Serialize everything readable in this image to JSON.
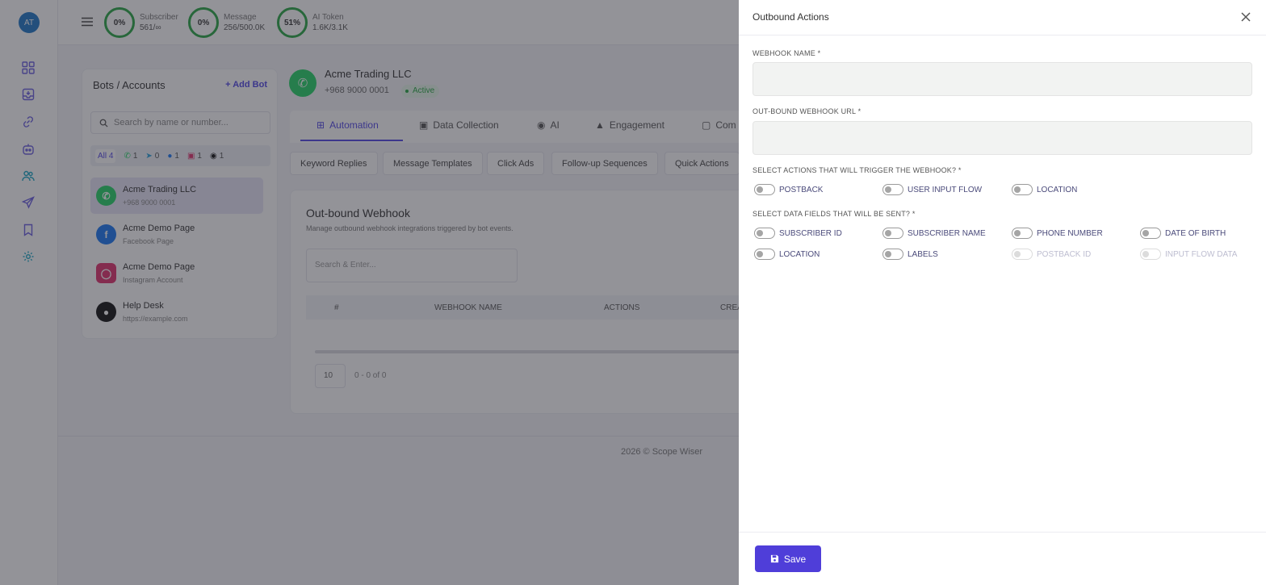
{
  "user": {
    "initials": "AT"
  },
  "stats": [
    {
      "percent": "0%",
      "label": "Subscriber",
      "value": "561/∞"
    },
    {
      "percent": "0%",
      "label": "Message",
      "value": "256/500.0K"
    },
    {
      "percent": "51%",
      "label": "AI Token",
      "value": "1.6K/3.1K"
    }
  ],
  "bots_panel": {
    "title": "Bots / Accounts",
    "add_label": "Add Bot",
    "search_placeholder": "Search by name or number...",
    "filters": {
      "all": "All 4",
      "whatsapp": "1",
      "telegram": "0",
      "facebook": "1",
      "instagram": "1",
      "threads": "1"
    },
    "items": [
      {
        "name": "Acme Trading LLC",
        "sub": "+968 9000 0001",
        "icon": "whatsapp-icon",
        "color": "#25d366"
      },
      {
        "name": "Acme Demo Page",
        "sub": "Facebook Page",
        "icon": "facebook-icon",
        "color": "#1877f2"
      },
      {
        "name": "Acme Demo Page",
        "sub": "Instagram Account",
        "icon": "instagram-icon",
        "color": "#e1306c"
      },
      {
        "name": "Help Desk",
        "sub": "https://example.com",
        "icon": "chat-icon",
        "color": "#111111"
      }
    ]
  },
  "account": {
    "name": "Acme Trading LLC",
    "number": "+968 9000 0001",
    "status": "Active"
  },
  "tabs": [
    "Automation",
    "Data Collection",
    "AI",
    "Engagement",
    "Com"
  ],
  "subtabs": [
    "Keyword Replies",
    "Message Templates",
    "Click Ads",
    "Follow-up Sequences",
    "Quick Actions"
  ],
  "webhook_card": {
    "title": "Out-bound Webhook",
    "description": "Manage outbound webhook integrations triggered by bot events.",
    "search_placeholder": "Search & Enter...",
    "columns": [
      "#",
      "WEBHOOK NAME",
      "ACTIONS",
      "CREA"
    ],
    "per_page": "10",
    "page_info": "0 - 0 of 0"
  },
  "footer": "2026 © Scope Wiser",
  "drawer": {
    "title": "Outbound Actions",
    "webhook_name_label": "WEBHOOK NAME *",
    "webhook_url_label": "OUT-BOUND WEBHOOK URL *",
    "trigger_label": "SELECT ACTIONS THAT WILL TRIGGER THE WEBHOOK? *",
    "trigger_options": [
      "POSTBACK",
      "USER INPUT FLOW",
      "LOCATION"
    ],
    "fields_label": "SELECT DATA FIELDS THAT WILL BE SENT? *",
    "field_options": [
      "SUBSCRIBER ID",
      "SUBSCRIBER NAME",
      "PHONE NUMBER",
      "DATE OF BIRTH",
      "LOCATION",
      "LABELS",
      "POSTBACK ID",
      "INPUT FLOW DATA"
    ],
    "save_label": "Save"
  }
}
